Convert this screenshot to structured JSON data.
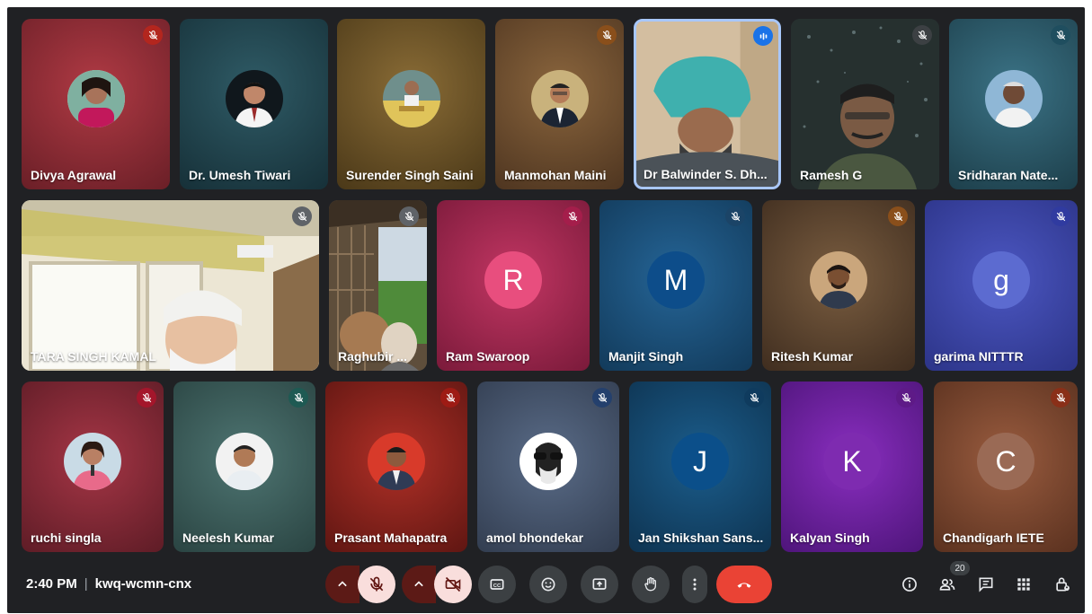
{
  "meeting": {
    "time": "2:40 PM",
    "code": "kwq-wcmn-cnx",
    "participant_count": "20"
  },
  "participants": [
    {
      "name": "Divya Agrawal",
      "bg": "#8a2530",
      "mic": "#b3261e"
    },
    {
      "name": "Dr. Umesh Tiwari",
      "bg": "#22434c",
      "mic": ""
    },
    {
      "name": "Surender Singh Saini",
      "bg": "#6e5527",
      "mic": ""
    },
    {
      "name": "Manmohan Maini",
      "bg": "#6b4b2c",
      "mic": "#8a4f1b"
    },
    {
      "name": "Dr Balwinder S. Dh...",
      "bg": "#c9b59a",
      "mic": "#1a73e8"
    },
    {
      "name": "Ramesh G",
      "bg": "#2b3134",
      "mic": ""
    },
    {
      "name": "Sridharan Nate...",
      "bg": "#2a5b6a",
      "mic": "#1f4e5f"
    },
    {
      "name": "TARA SINGH KAMAL",
      "bg": "#d8cdb3",
      "mic": "#5f6368"
    },
    {
      "name": "Raghubir ...",
      "bg": "#5a4b3a",
      "mic": "#5f6368"
    },
    {
      "name": "Ram Swaroop",
      "bg": "#a8294f",
      "mic": "#a41e4b",
      "initial": "R",
      "avatar_bg": "#e24a78"
    },
    {
      "name": "Manjit Singh",
      "bg": "#1c4f7a",
      "mic": "#1b4467",
      "initial": "M",
      "avatar_bg": "#0d4d8a"
    },
    {
      "name": "Ritesh Kumar",
      "bg": "#5e4630",
      "mic": "#8a4f1b"
    },
    {
      "name": "garima NITTTR",
      "bg": "#3d46a8",
      "mic": "#303ba0",
      "initial": "g",
      "avatar_bg": "#5c6bd0"
    },
    {
      "name": "ruchi singla",
      "bg": "#8c2b3a",
      "mic": "#a4162b"
    },
    {
      "name": "Neelesh Kumar",
      "bg": "#3b5e5c",
      "mic": "#1e5a53"
    },
    {
      "name": "Prasant Mahapatra",
      "bg": "#8e2320",
      "mic": "#9e1b14"
    },
    {
      "name": "amol bhondekar",
      "bg": "#4c5c74",
      "mic": "#24406d"
    },
    {
      "name": "Jan Shikshan Sans...",
      "bg": "#13466e",
      "mic": "#0f3b5e",
      "initial": "J",
      "avatar_bg": "#0b4f8a"
    },
    {
      "name": "Kalyan Singh",
      "bg": "#6d1f9a",
      "mic": "#5e1a87",
      "initial": "K",
      "avatar_bg": "#7e2bb0"
    },
    {
      "name": "Chandigarh IETE",
      "bg": "#7a4a34",
      "mic": "#8a2f18",
      "initial": "C",
      "avatar_bg": "#9a6a55"
    }
  ],
  "controls": [
    {
      "name": "mic-options-button",
      "icon": "chevron-up-icon"
    },
    {
      "name": "mic-toggle-button",
      "icon": "mic-off-icon"
    },
    {
      "name": "camera-options-button",
      "icon": "chevron-up-icon"
    },
    {
      "name": "camera-toggle-button",
      "icon": "camera-off-icon"
    },
    {
      "name": "captions-button",
      "icon": "captions-icon"
    },
    {
      "name": "reactions-button",
      "icon": "emoji-icon"
    },
    {
      "name": "present-button",
      "icon": "present-icon"
    },
    {
      "name": "raise-hand-button",
      "icon": "hand-icon"
    },
    {
      "name": "more-options-button",
      "icon": "more-vert-icon"
    },
    {
      "name": "leave-call-button",
      "icon": "call-end-icon"
    }
  ],
  "right_controls": [
    {
      "name": "meeting-details-button",
      "icon": "info-icon"
    },
    {
      "name": "people-button",
      "icon": "people-icon"
    },
    {
      "name": "chat-button",
      "icon": "chat-icon"
    },
    {
      "name": "activities-button",
      "icon": "apps-icon"
    },
    {
      "name": "host-controls-button",
      "icon": "lock-person-icon"
    }
  ]
}
